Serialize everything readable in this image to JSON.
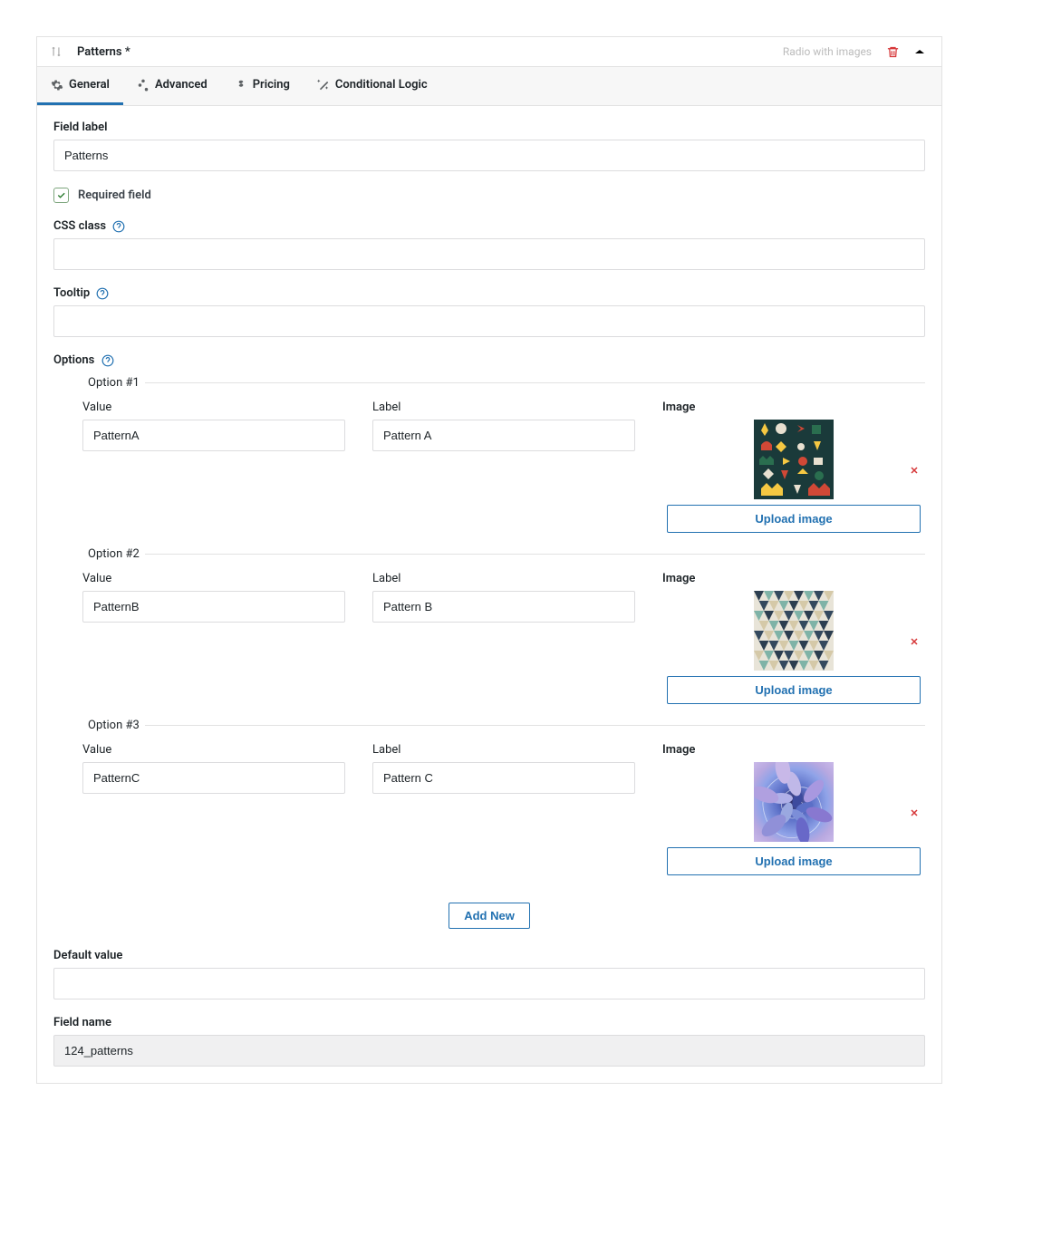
{
  "header": {
    "title": "Patterns *",
    "type": "Radio with images"
  },
  "tabs": [
    {
      "id": "general",
      "label": "General",
      "active": true
    },
    {
      "id": "advanced",
      "label": "Advanced",
      "active": false
    },
    {
      "id": "pricing",
      "label": "Pricing",
      "active": false
    },
    {
      "id": "conditional",
      "label": "Conditional Logic",
      "active": false
    }
  ],
  "form": {
    "field_label_label": "Field label",
    "field_label_value": "Patterns",
    "required_label": "Required field",
    "required_checked": true,
    "css_class_label": "CSS class",
    "css_class_value": "",
    "tooltip_label": "Tooltip",
    "tooltip_value": "",
    "options_label": "Options",
    "default_value_label": "Default value",
    "default_value_value": "",
    "field_name_label": "Field name",
    "field_name_value": "124_patterns",
    "option_value_label": "Value",
    "option_label_label": "Label",
    "option_image_label": "Image",
    "upload_button": "Upload image",
    "add_button": "Add New"
  },
  "options": [
    {
      "legend": "Option #1",
      "value": "PatternA",
      "label": "Pattern A"
    },
    {
      "legend": "Option #2",
      "value": "PatternB",
      "label": "Pattern B"
    },
    {
      "legend": "Option #3",
      "value": "PatternC",
      "label": "Pattern C"
    }
  ]
}
